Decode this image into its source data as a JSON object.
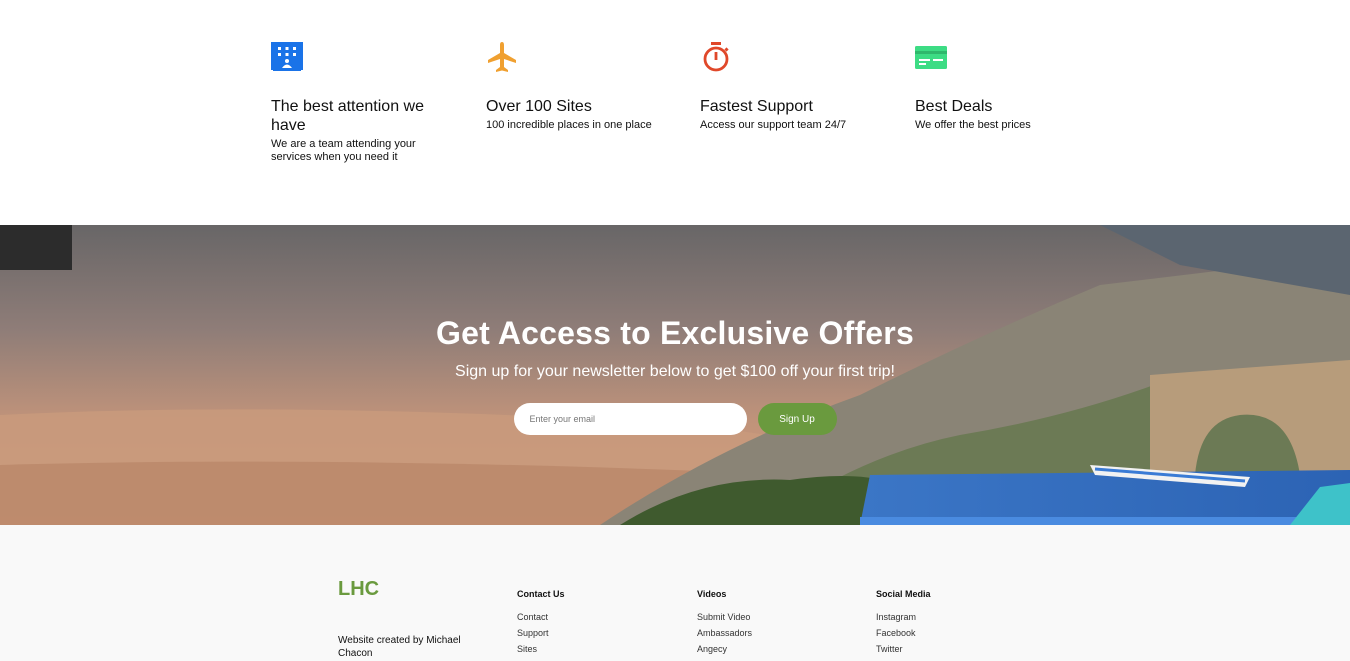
{
  "features": [
    {
      "icon": "hotel-icon",
      "color": "#1a73e8",
      "title": "The best attention we have",
      "description": "We are a team attending your services when you need it"
    },
    {
      "icon": "airplane-icon",
      "color": "#f0a030",
      "title": "Over 100 Sites",
      "description": "100 incredible places in one place"
    },
    {
      "icon": "stopwatch-icon",
      "color": "#e0482a",
      "title": "Fastest Support",
      "description": "Access our support team 24/7"
    },
    {
      "icon": "credit-card-icon",
      "color": "#3ddc84",
      "title": "Best Deals",
      "description": "We offer the best prices"
    }
  ],
  "newsletter": {
    "title": "Get Access to Exclusive Offers",
    "subtitle": "Sign up for your newsletter below to get $100 off your first trip!",
    "email_placeholder": "Enter your email",
    "button_label": "Sign Up",
    "button_color": "#6a9a3e"
  },
  "footer": {
    "logo": "LHC",
    "logo_color": "#6a9a3e",
    "credit": "Website created by Michael Chacon",
    "columns": [
      {
        "heading": "Contact Us",
        "links": [
          "Contact",
          "Support",
          "Sites"
        ]
      },
      {
        "heading": "Videos",
        "links": [
          "Submit Video",
          "Ambassadors",
          "Angecy"
        ]
      },
      {
        "heading": "Social Media",
        "links": [
          "Instagram",
          "Facebook",
          "Twitter"
        ]
      }
    ]
  }
}
